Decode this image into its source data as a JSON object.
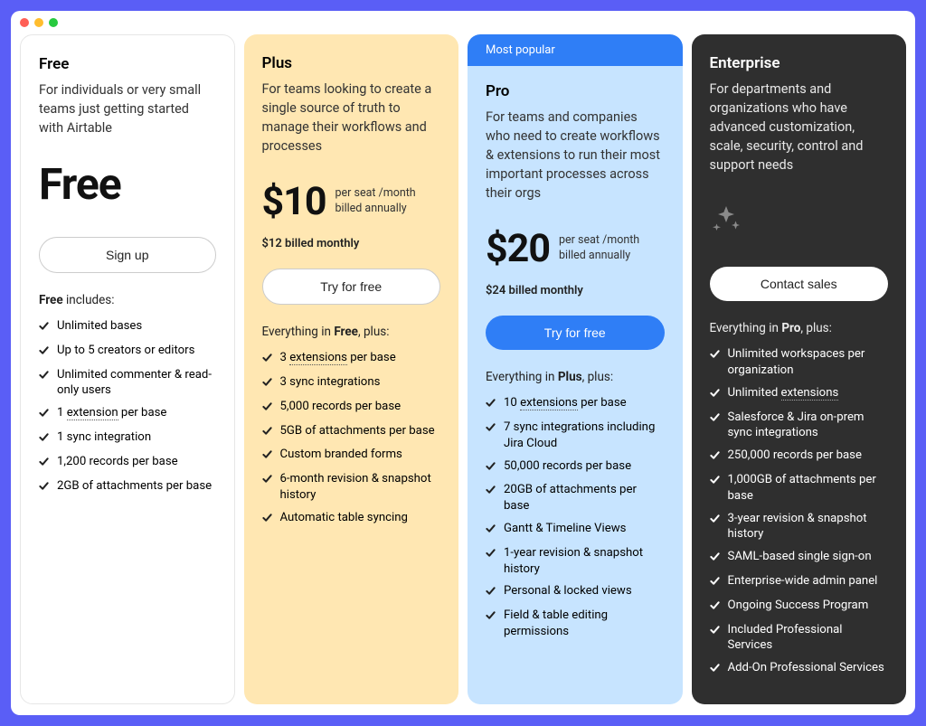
{
  "plans": [
    {
      "key": "free",
      "name": "Free",
      "desc": "For individuals or very small teams just getting started with Airtable",
      "price": "Free",
      "price_sub1": "",
      "price_sub2": "",
      "price_monthly": "",
      "cta": "Sign up",
      "cta_style": "outline",
      "includes_prefix": "Free",
      "includes_suffix": " includes:",
      "features": [
        "Unlimited bases",
        "Up to 5 creators or editors",
        "Unlimited commenter & read-only users",
        "1 |u|extension|/u| per base",
        "1 sync integration",
        "1,200 records per base",
        "2GB of attachments per base"
      ]
    },
    {
      "key": "plus",
      "name": "Plus",
      "desc": "For teams looking to create a single source of truth to manage their workflows and processes",
      "price": "$10",
      "price_sub1": "per seat /month",
      "price_sub2": "billed annually",
      "price_monthly": "$12 billed monthly",
      "cta": "Try for free",
      "cta_style": "outline",
      "includes_prefix_plain": "Everything in ",
      "includes_bold": "Free",
      "includes_suffix": ", plus:",
      "features": [
        "3 |u|extensions|/u| per base",
        "3 sync integrations",
        "5,000 records per base",
        "5GB of attachments per base",
        "Custom branded forms",
        "6-month revision & snapshot history",
        "Automatic table syncing"
      ]
    },
    {
      "key": "pro",
      "badge": "Most popular",
      "name": "Pro",
      "desc": "For teams and companies who need to create workflows & extensions to run their most important processes across their orgs",
      "price": "$20",
      "price_sub1": "per seat /month",
      "price_sub2": "billed annually",
      "price_monthly": "$24 billed monthly",
      "cta": "Try for free",
      "cta_style": "primary",
      "includes_prefix_plain": "Everything in ",
      "includes_bold": "Plus",
      "includes_suffix": ", plus:",
      "features": [
        "10 |u|extensions|/u| per base",
        "7 sync integrations including Jira Cloud",
        "50,000 records per base",
        "20GB of attachments per base",
        "Gantt & Timeline Views",
        "1-year revision & snapshot history",
        "Personal & locked views",
        "Field & table editing permissions"
      ]
    },
    {
      "key": "ent",
      "name": "Enterprise",
      "desc": "For departments and organizations who have advanced customization, scale, security, control and support needs",
      "price": "",
      "cta": "Contact sales",
      "cta_style": "white",
      "includes_prefix_plain": "Everything in ",
      "includes_bold": "Pro",
      "includes_suffix": ", plus:",
      "features": [
        "Unlimited workspaces per organization",
        "Unlimited |u|extensions|/u|",
        "Salesforce & Jira on-prem sync integrations",
        "250,000 records per base",
        "1,000GB of attachments per base",
        "3-year revision & snapshot history",
        "SAML-based single sign-on",
        "Enterprise-wide admin panel",
        "Ongoing Success Program",
        "Included Professional Services",
        "Add-On Professional Services"
      ]
    }
  ]
}
